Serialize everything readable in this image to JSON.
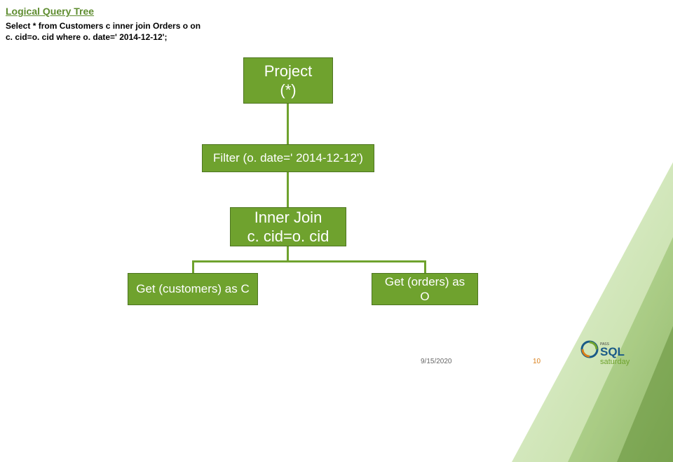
{
  "title": "Logical Query Tree",
  "sql": {
    "line1": "Select * from Customers c inner join Orders o on",
    "line2": "c. cid=o. cid where o. date=' 2014-12-12';"
  },
  "nodes": {
    "project": "Project\n(*)",
    "filter": "Filter (o. date=' 2014-12-12')",
    "join": "Inner Join\nc. cid=o. cid",
    "get_customers": "Get (customers) as C",
    "get_orders": "Get (orders) as\nO"
  },
  "footer": {
    "date": "9/15/2020",
    "page": "10"
  },
  "logo": {
    "name": "PASS SQL Saturday",
    "sql_text": "SQL",
    "sub_text": "saturday",
    "pass_text": "PASS"
  },
  "colors": {
    "node_fill": "#6fa22e",
    "node_border": "#4d7520",
    "title_green": "#5e8c2f",
    "page_orange": "#d97f1a"
  }
}
